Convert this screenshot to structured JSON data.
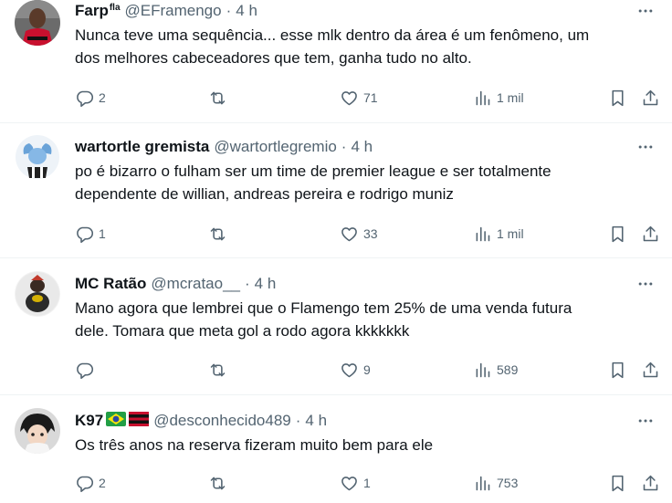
{
  "tweets": [
    {
      "name": "Farp",
      "name_sup": "fla",
      "handle": "@EFramengo",
      "sep": "·",
      "time": "4 h",
      "text": "Nunca teve uma sequência... esse mlk dentro da área é um fenômeno, um\ndos melhores cabeceadores que tem, ganha tudo no alto.",
      "replies": "2",
      "retweets": "",
      "likes": "71",
      "views": "1 mil"
    },
    {
      "name": "wartortle gremista",
      "handle": "@wartortlegremio",
      "sep": "·",
      "time": "4 h",
      "text": "po é bizarro o fulham ser um time de premier league e ser totalmente\ndependente de willian, andreas pereira e rodrigo muniz",
      "replies": "1",
      "retweets": "",
      "likes": "33",
      "views": "1 mil"
    },
    {
      "name": "MC Ratão",
      "handle": "@mcratao__",
      "sep": "·",
      "time": "4 h",
      "text": "Mano agora que lembrei que o Flamengo tem 25% de uma venda futura\ndele. Tomara que meta gol a rodo agora kkkkkkk",
      "replies": "",
      "retweets": "",
      "likes": "9",
      "views": "589"
    },
    {
      "name": "K97",
      "handle": "@desconhecido489",
      "sep": "·",
      "time": "4 h",
      "text": "Os três anos na reserva fizeram muito bem para ele",
      "replies": "2",
      "retweets": "",
      "likes": "1",
      "views": "753"
    }
  ],
  "icons": {
    "more": "more-horizontal-icon",
    "reply": "reply-icon",
    "retweet": "retweet-icon",
    "like": "heart-icon",
    "views": "views-icon",
    "bookmark": "bookmark-icon",
    "share": "share-icon"
  },
  "colors": {
    "text": "#0f1419",
    "secondary": "#536471",
    "divider": "#eff3f4"
  }
}
